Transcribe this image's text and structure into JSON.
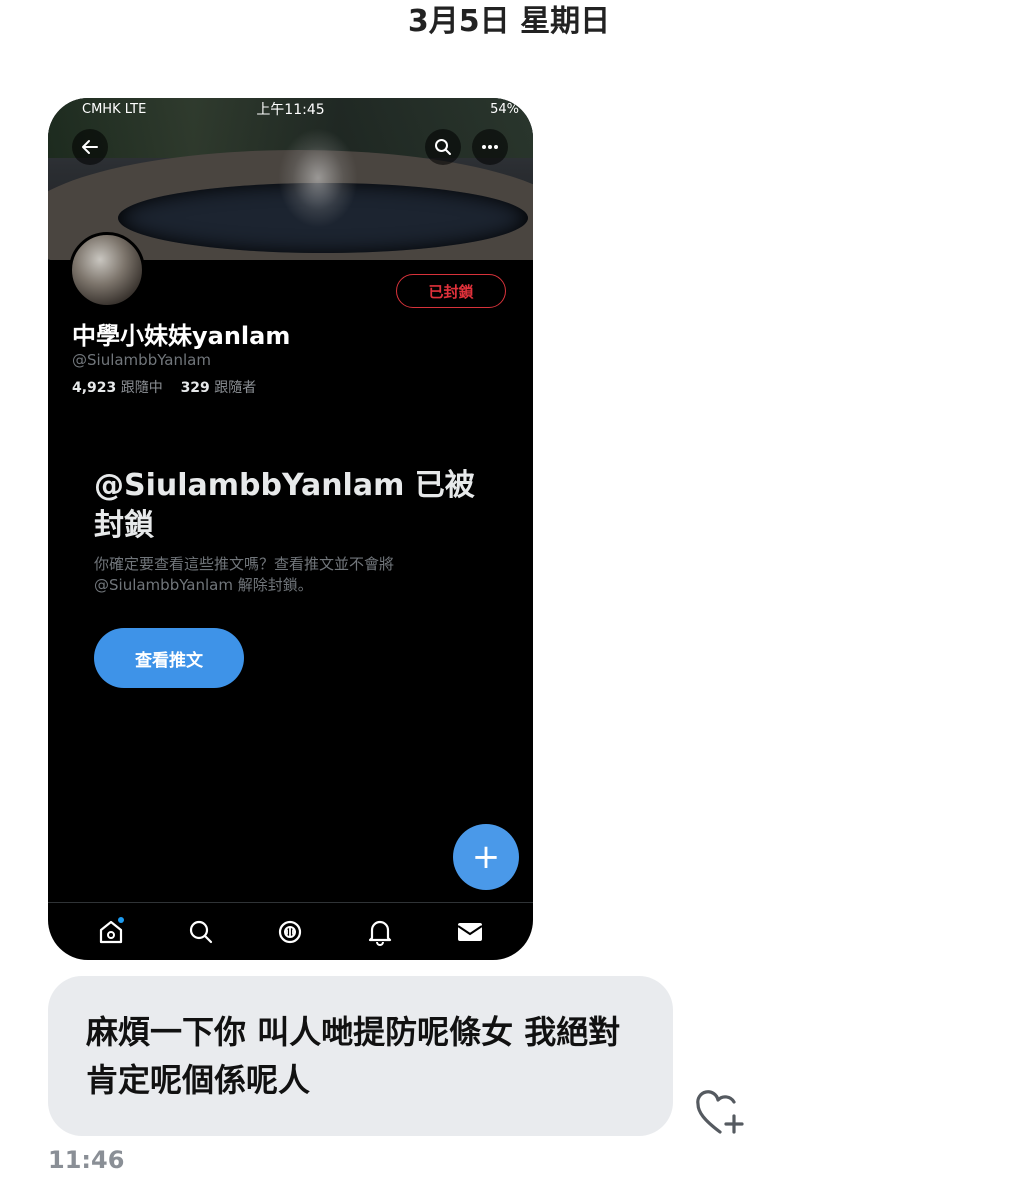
{
  "date_header": "3月5日 星期日",
  "screenshot": {
    "status_bar": {
      "carrier": "CMHK  LTE",
      "time": "上午11:45",
      "battery": "54%"
    },
    "icons": {
      "back": "arrow-left-icon",
      "search": "search-icon",
      "more": "more-icon"
    },
    "profile": {
      "blocked_button": "已封鎖",
      "display_name": "中學小妹妹yanlam",
      "handle": "@SiulambbYanlam",
      "following_count": "4,923",
      "following_label": "跟隨中",
      "followers_count": "329",
      "followers_label": "跟隨者"
    },
    "blocked_notice": {
      "title": "@SiulambbYanlam 已被封鎖",
      "description": "你確定要查看這些推文嗎？查看推文並不會將 @SiulambbYanlam 解除封鎖。",
      "button": "查看推文"
    },
    "fab_label": "+",
    "tabs": [
      "home-icon",
      "search-icon",
      "spaces-icon",
      "notifications-icon",
      "messages-icon"
    ]
  },
  "message": {
    "text": "麻煩一下你 叫人哋提防呢條女 我絕對肯定呢個係呢人",
    "time": "11:46"
  },
  "colors": {
    "blocked_red": "#e0313b",
    "twitter_blue": "#3e93e8",
    "bubble_bg": "#e9ebee"
  }
}
